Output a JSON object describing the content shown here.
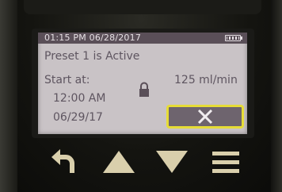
{
  "status_bar": {
    "datetime": "01:15 PM 06/28/2017",
    "battery_icon": "battery-icon"
  },
  "main": {
    "headline": "Preset 1 is Active",
    "start_label": "Start at:",
    "start_time": "12:00 AM",
    "start_date": "06/29/17",
    "rate": "125 ml/min",
    "lock_icon": "lock-icon",
    "cancel_icon": "close-icon"
  },
  "nav": {
    "back_icon": "back-arrow-icon",
    "up_icon": "up-arrow-icon",
    "down_icon": "down-arrow-icon",
    "menu_icon": "menu-icon"
  },
  "colors": {
    "screen_bg": "#c9c3c6",
    "status_bar": "#5a4f58",
    "text": "#5e5560",
    "highlight": "#e6dc36",
    "button_glyph": "#d9cfac"
  }
}
